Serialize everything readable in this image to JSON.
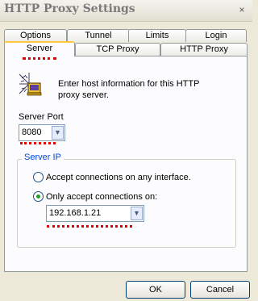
{
  "window": {
    "title": "HTTP Proxy Settings",
    "close_glyph": "×"
  },
  "tabs": {
    "top_row": [
      {
        "label": "Options"
      },
      {
        "label": "Tunnel"
      },
      {
        "label": "Limits"
      },
      {
        "label": "Login"
      }
    ],
    "bottom_row": [
      {
        "label": "Server",
        "active": true
      },
      {
        "label": "TCP Proxy"
      },
      {
        "label": "HTTP Proxy"
      }
    ]
  },
  "server_tab": {
    "icon": "network-proxy-icon",
    "info_text": "Enter host information for this HTTP proxy server.",
    "server_port": {
      "label": "Server Port",
      "value": "8080"
    },
    "server_ip": {
      "group_label": "Server IP",
      "options": [
        {
          "label": "Accept connections on any interface.",
          "selected": false
        },
        {
          "label": "Only accept connections on:",
          "selected": true
        }
      ],
      "selected_address": "192.168.1.21"
    }
  },
  "buttons": {
    "ok": "OK",
    "cancel": "Cancel"
  },
  "dropdown_glyph": "▼",
  "colors": {
    "annotation_red": "#e00000",
    "selected_tab_accent": "#ffc83c",
    "group_title": "#0046d5"
  }
}
